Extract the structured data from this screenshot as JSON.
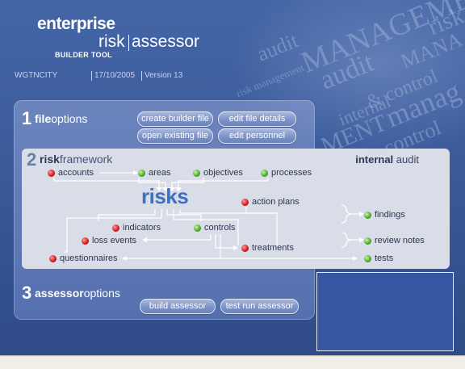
{
  "logo": {
    "line1": "enterprise",
    "line2a": "risk",
    "line2b": "assessor",
    "line3": "BUILDER TOOL"
  },
  "status": {
    "org": "WGTNCITY",
    "date": "17/10/2005",
    "version": "Version  13"
  },
  "watermark_words": [
    "MANAGEMENT",
    "audit",
    "risk",
    "MANA",
    "audit",
    "& control",
    "internal",
    "manag",
    "MENT",
    "control",
    "risk management",
    "contr",
    "audit"
  ],
  "file_section": {
    "num": "1",
    "title_bold": "file",
    "title_rest": "options",
    "buttons": {
      "create": "create builder file",
      "edit_details": "edit file details",
      "open": "open existing file",
      "edit_personnel": "edit personnel"
    }
  },
  "risk_section": {
    "num": "2",
    "title_bold": "risk",
    "title_rest": "framework",
    "right_bold": "internal",
    "right_rest": " audit",
    "center": "risks",
    "nodes": {
      "accounts": "accounts",
      "areas": "areas",
      "objectives": "objectives",
      "processes": "processes",
      "action_plans": "action plans",
      "indicators": "indicators",
      "controls": "controls",
      "loss_events": "loss events",
      "treatments": "treatments",
      "questionnaires": "questionnaires",
      "findings": "findings",
      "review_notes": "review notes",
      "tests": "tests"
    },
    "colors": {
      "red_dot": "#d01818",
      "green_dot": "#4aa82a",
      "risks_text": "#3d6fc4"
    }
  },
  "assessor_section": {
    "num": "3",
    "title_bold": "assessor",
    "title_rest": "options",
    "buttons": {
      "build": "build assessor",
      "test_run": "test run assessor"
    }
  },
  "colors": {
    "background": "#3c5c9c",
    "panel": "#5f78b4",
    "risk_panel": "#d9dde8"
  }
}
